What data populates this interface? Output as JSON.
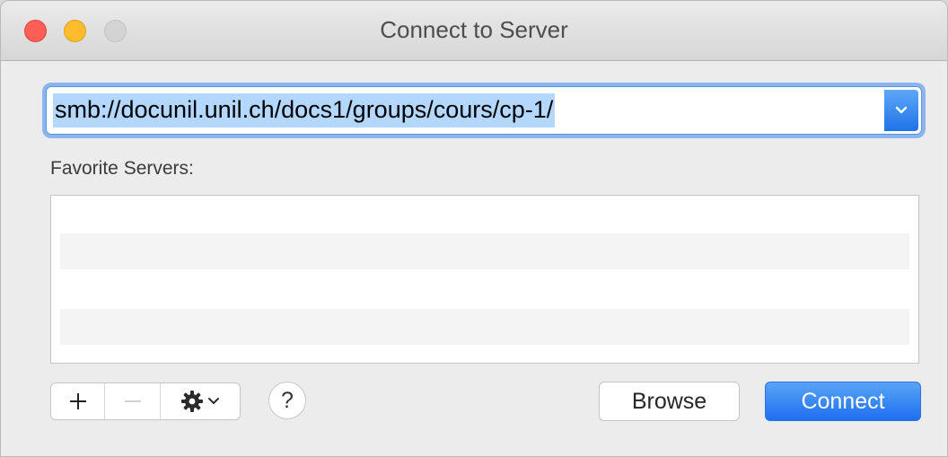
{
  "window": {
    "title": "Connect to Server"
  },
  "server_address": {
    "value": "smb://docunil.unil.ch/docs1/groups/cours/cp-1/"
  },
  "favorites": {
    "label": "Favorite Servers:",
    "items": []
  },
  "toolbar": {
    "add_symbol": "+",
    "remove_symbol": "—",
    "help_symbol": "?"
  },
  "buttons": {
    "browse_label": "Browse",
    "connect_label": "Connect"
  },
  "colors": {
    "accent": "#1c6ff0",
    "selection": "#b3d7ff",
    "close": "#fd5f57",
    "minimize": "#fdbc2e",
    "zoom": "#d3d3d3"
  },
  "icons": {
    "add": "plus-icon",
    "remove": "minus-icon",
    "action": "gear-icon",
    "dropdown": "chevron-down-icon",
    "help": "question-mark-icon"
  }
}
